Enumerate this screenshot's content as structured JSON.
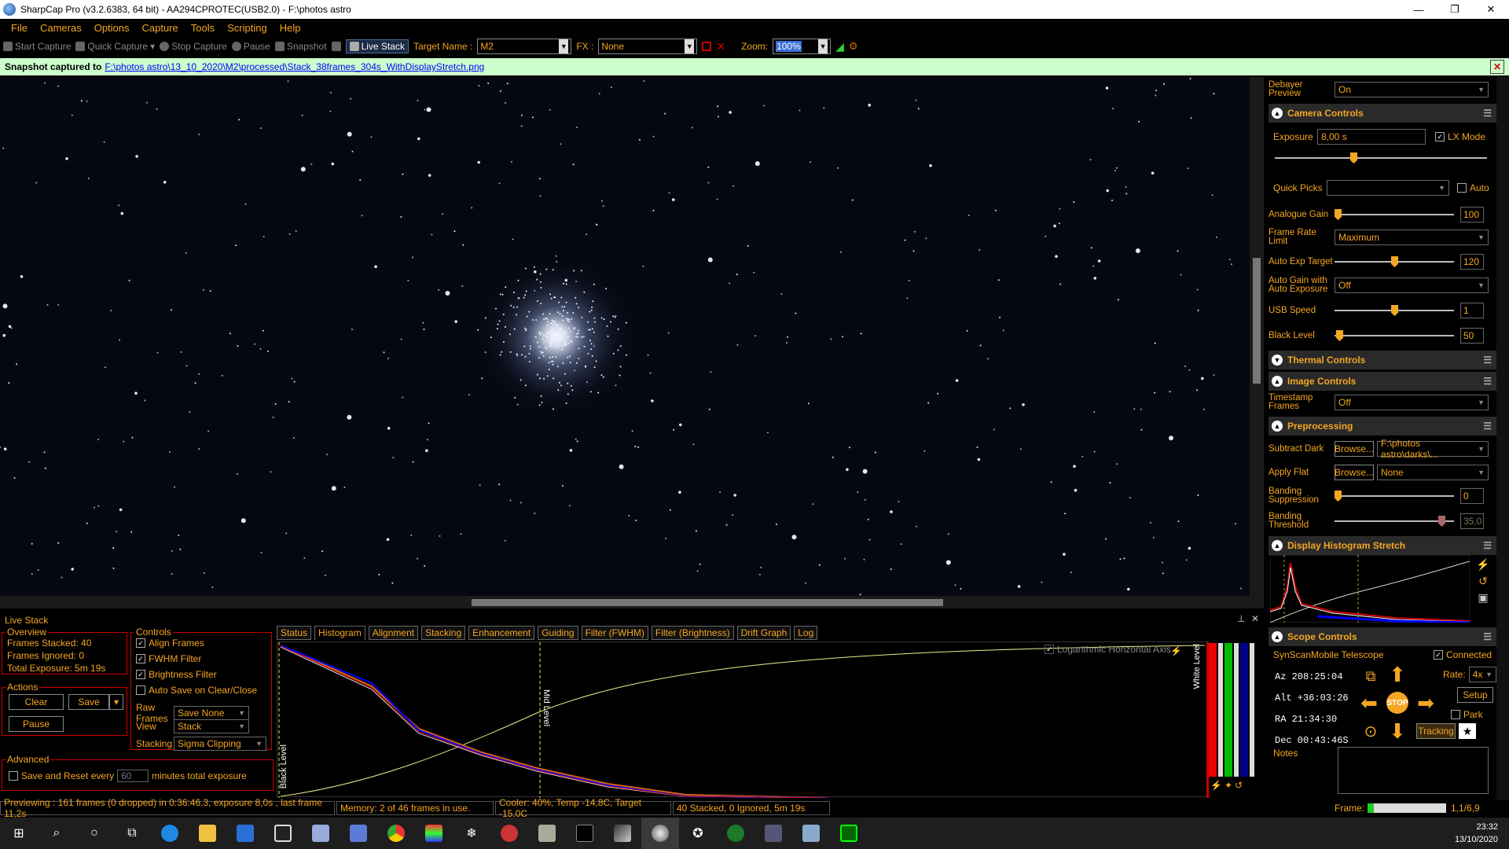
{
  "window": {
    "title": "SharpCap Pro (v3.2.6383, 64 bit) - AA294CPROTEC(USB2.0) - F:\\photos astro",
    "minimize": "—",
    "restore": "❐",
    "close": "✕"
  },
  "menu": [
    "File",
    "Cameras",
    "Options",
    "Capture",
    "Tools",
    "Scripting",
    "Help"
  ],
  "toolbar": {
    "start_capture": "Start Capture",
    "quick_capture": "Quick Capture",
    "stop_capture": "Stop Capture",
    "pause": "Pause",
    "snapshot": "Snapshot",
    "live_stack": "Live Stack",
    "target_label": "Target Name :",
    "target_value": "M2",
    "fx_label": "FX :",
    "fx_value": "None",
    "zoom_label": "Zoom:",
    "zoom_value": "100%"
  },
  "snapshot": {
    "prefix": "Snapshot captured to",
    "path": "F:\\photos astro\\13_10_2020\\M2\\processed\\Stack_38frames_304s_WithDisplayStretch.png",
    "close": "✕"
  },
  "right": {
    "debayer_label": "Debayer Preview",
    "debayer_value": "On",
    "camera_controls": "Camera Controls",
    "exposure_label": "Exposure",
    "exposure_value": "8,00 s",
    "lx_mode": "LX Mode",
    "quick_picks": "Quick Picks",
    "auto": "Auto",
    "analogue_gain": "Analogue Gain",
    "analogue_gain_value": "100",
    "frame_rate_label": "Frame Rate Limit",
    "frame_rate_value": "Maximum",
    "auto_exp_label": "Auto Exp Target",
    "auto_exp_value": "120",
    "auto_gain_label": "Auto Gain with Auto Exposure",
    "auto_gain_value": "Off",
    "usb_label": "USB Speed",
    "usb_value": "1",
    "black_label": "Black Level",
    "black_value": "50",
    "thermal": "Thermal Controls",
    "image": "Image Controls",
    "timestamp_label": "Timestamp Frames",
    "timestamp_value": "Off",
    "preprocessing": "Preprocessing",
    "subtract_dark": "Subtract Dark",
    "browse": "Browse...",
    "dark_value": "F:\\photos astro\\darks\\...",
    "apply_flat": "Apply Flat",
    "flat_value": "None",
    "banding_supp": "Banding Suppression",
    "banding_supp_value": "0",
    "banding_thr": "Banding Threshold",
    "banding_thr_value": "35,0",
    "display_hist": "Display Histogram Stretch",
    "scope": "Scope Controls",
    "scope_name": "SynScanMobile Telescope",
    "connected": "Connected",
    "az": "Az  208:25:04",
    "alt": "Alt +36:03:26",
    "ra": "RA  21:34:30",
    "dec": "Dec 00:43:46S",
    "rate_label": "Rate:",
    "rate_value": "4x",
    "setup": "Setup",
    "park": "Park",
    "stop": "STOP",
    "tracking": "Tracking",
    "notes": "Notes"
  },
  "livestack": {
    "title": "Live Stack",
    "overview": "Overview",
    "frames_stacked": "Frames Stacked: 40",
    "frames_ignored": "Frames Ignored:  0",
    "total_exposure": "Total Exposure:  5m 19s",
    "actions": "Actions",
    "clear": "Clear",
    "save": "Save",
    "pause": "Pause",
    "advanced": "Advanced",
    "save_reset": "Save and Reset every",
    "minutes": "60",
    "minutes_label": "minutes total exposure",
    "controls": "Controls",
    "align": "Align Frames",
    "fwhm": "FWHM Filter",
    "brightness": "Brightness Filter",
    "autosave": "Auto Save on Clear/Close",
    "raw_label": "Raw Frames",
    "raw_value": "Save None",
    "view_label": "View",
    "view_value": "Stack",
    "stacking_label": "Stacking",
    "stacking_value": "Sigma Clipping",
    "tabs": [
      "Status",
      "Histogram",
      "Alignment",
      "Stacking",
      "Enhancement",
      "Guiding",
      "Filter (FWHM)",
      "Filter (Brightness)",
      "Drift Graph",
      "Log"
    ],
    "log_axis": "Logarithmic Horizontal Axis",
    "black_level": "Black Level",
    "mid_level": "Mid Level",
    "white_level": "White Level"
  },
  "status": {
    "preview": "Previewing : 161 frames (0 dropped) in 0:36:46,3, exposure 8,0s , last frame 11,2s",
    "memory": "Memory: 2 of 46 frames in use.",
    "cooler": "Cooler: 40%, Temp -14,8C, Target -15,0C",
    "stacked": "40 Stacked, 0 Ignored, 5m 19s",
    "frame_label": "Frame:",
    "frame_value": "1,1/6,9"
  },
  "clock": {
    "time": "23:32",
    "date": "13/10/2020"
  }
}
